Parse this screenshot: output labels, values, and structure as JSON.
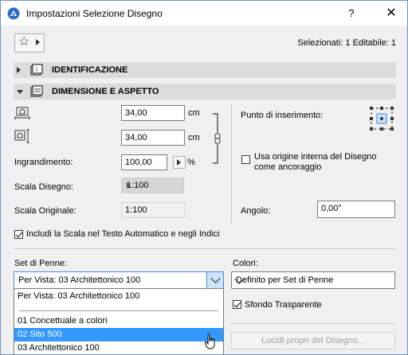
{
  "window": {
    "title": "Impostazioni Selezione Disegno",
    "help_label": "?",
    "close_label": "✕"
  },
  "header": {
    "selection_info": "Selezionati: 1 Editabile: 1"
  },
  "sections": {
    "identification": "IDENTIFICAZIONE",
    "dimension": "DIMENSIONE E ASPETTO"
  },
  "dimension": {
    "width_value": "34,00",
    "width_unit": "cm",
    "height_value": "34,00",
    "height_unit": "cm",
    "magnification_label": "Ingrandimento:",
    "magnification_value": "100,00",
    "magnification_unit": "%",
    "drawing_scale_label": "Scala Disegno:",
    "drawing_scale_value": "1:100",
    "original_scale_label": "Scala Originale:",
    "original_scale_value": "1:100",
    "insertion_point_label": "Punto di inserimento:",
    "use_origin_label_1": "Usa origine interna del Disegno",
    "use_origin_label_2": "come ancoraggio",
    "use_origin_checked": false,
    "angle_label": "Angolo:",
    "angle_value": "0,00°",
    "include_scale_label": "Includi la Scala nel Testo Automatico e negli Indici",
    "include_scale_checked": true
  },
  "pens": {
    "pen_set_label": "Set di Penne:",
    "pen_set_value": "Per Vista: 03 Architettonico 100",
    "colors_label": "Colori:",
    "colors_value": "Definito per Set di Penne",
    "transparent_bg_label": "Sfondo Trasparente",
    "transparent_bg_checked": true,
    "layers_button": "Lucidi propri del Disegno..."
  },
  "dropdown": {
    "options": [
      "Per Vista: 03 Architettonico 100",
      "01 Concettuale a colori",
      "02 Sito 500",
      "03 Architettonico 100"
    ],
    "highlighted_index": 2
  },
  "colors": {
    "highlight": "#3399ff",
    "section_bg": "#dcdcdc",
    "accent": "#3a8ee6"
  }
}
